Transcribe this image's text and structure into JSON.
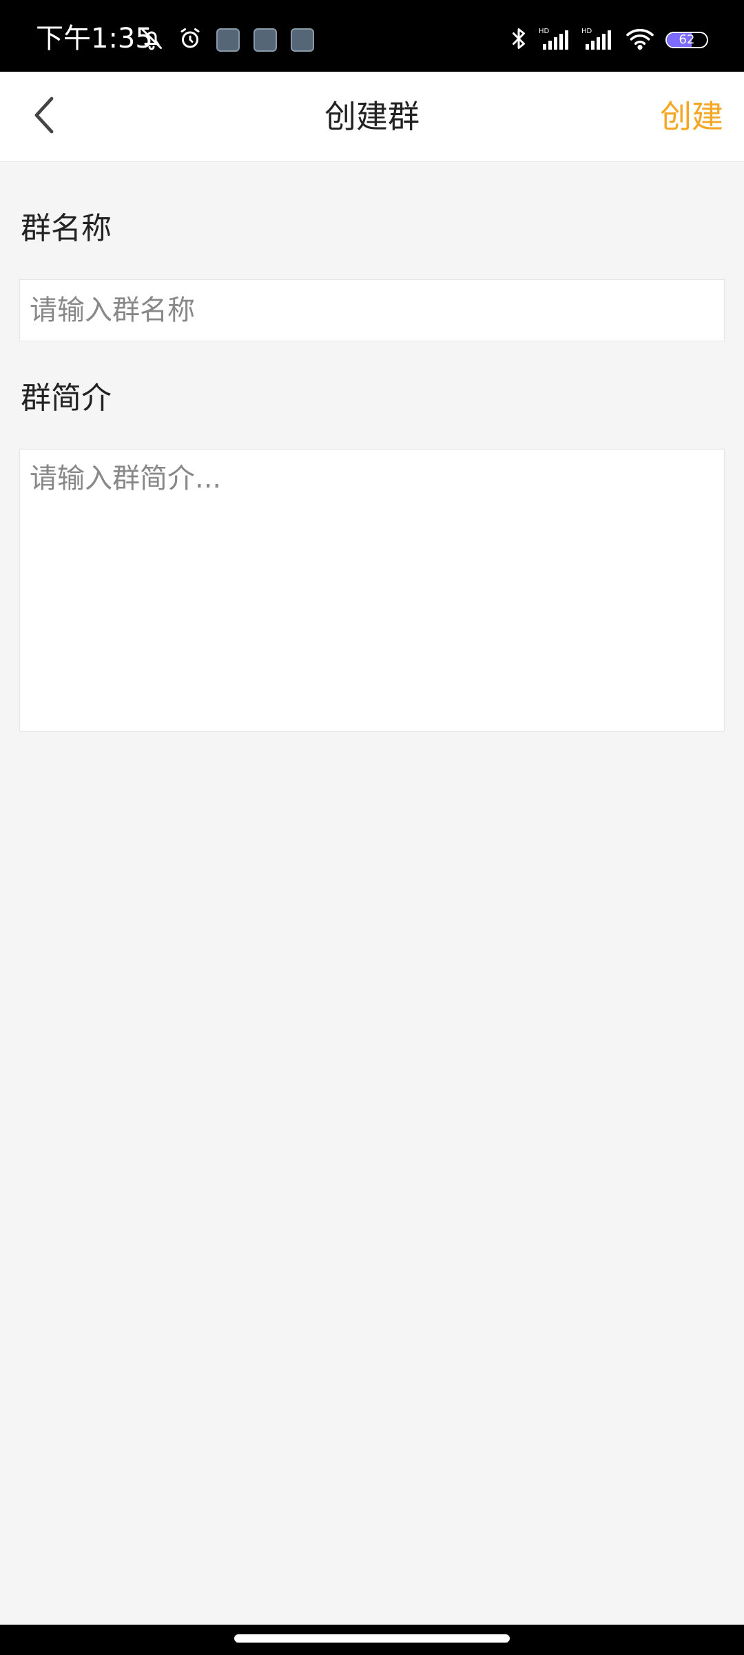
{
  "status_bar": {
    "time": "下午1:35",
    "battery_level": "62",
    "battery_fraction": 0.62,
    "icons_left": [
      "bell-off-icon",
      "alarm-icon",
      "app-notification-icon",
      "app-notification-icon",
      "app-notification-icon"
    ],
    "icons_right": [
      "bluetooth-icon",
      "signal-hd-icon",
      "signal-hd-icon",
      "wifi-icon",
      "battery-icon"
    ]
  },
  "header": {
    "title": "创建群",
    "action_label": "创建",
    "back_icon": "chevron-left-icon"
  },
  "form": {
    "name_label": "群名称",
    "name_value": "",
    "name_placeholder": "请输入群名称",
    "intro_label": "群简介",
    "intro_value": "",
    "intro_placeholder": "请输入群简介..."
  },
  "colors": {
    "accent": "#f5a623",
    "background": "#f5f5f5",
    "status_bar": "#000000",
    "battery_fill": "#7c6cff"
  }
}
